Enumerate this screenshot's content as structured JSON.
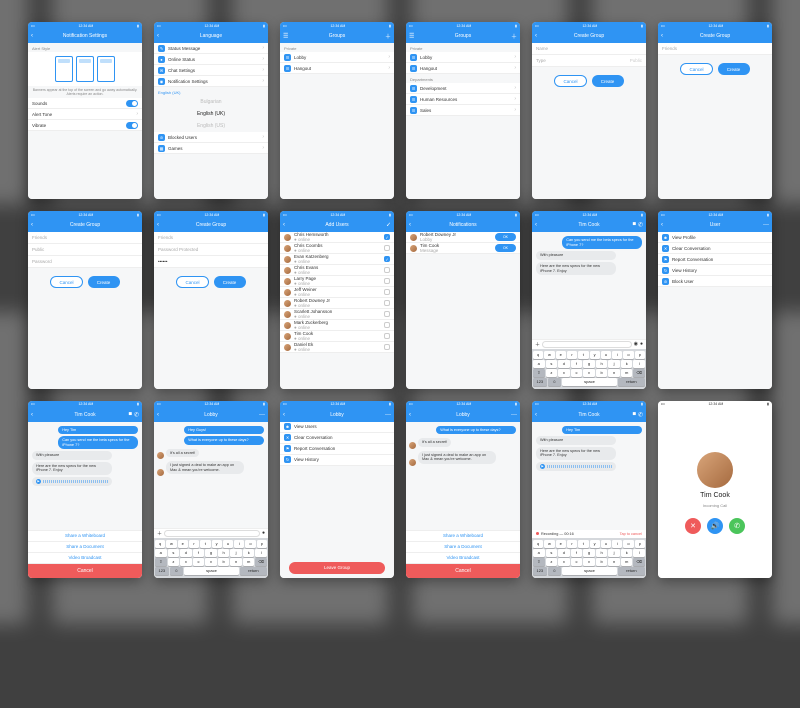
{
  "status": {
    "time": "12:34 AM"
  },
  "colors": {
    "primary": "#2f94f3",
    "danger": "#ef5b5b",
    "success": "#4bc55b"
  },
  "screens": {
    "notif_settings": {
      "title": "Notification Settings",
      "section": "Alert Style",
      "caption": "Banners appear at the top of the screen and go away automatically. Alerts require an action.",
      "rows": [
        {
          "label": "Sounds",
          "toggle": true
        },
        {
          "label": "Alert Tone",
          "chev": true
        },
        {
          "label": "Vibrate",
          "toggle": true
        }
      ]
    },
    "language": {
      "title": "Language",
      "settings": [
        {
          "label": "Status Message"
        },
        {
          "label": "Online Status"
        },
        {
          "label": "Chat Settings"
        },
        {
          "label": "Notification Settings"
        }
      ],
      "section_lang": "English (UK)",
      "langs": [
        {
          "label": "Bulgarian",
          "sel": false
        },
        {
          "label": "English (UK)",
          "sel": true
        },
        {
          "label": "English (US)",
          "sel": false
        }
      ],
      "more": [
        {
          "label": "Blocked Users"
        },
        {
          "label": "Games"
        }
      ]
    },
    "groups1": {
      "title": "Groups",
      "section": "Private",
      "items": [
        {
          "label": "Lobby"
        },
        {
          "label": "Hangout"
        }
      ]
    },
    "groups2": {
      "title": "Groups",
      "sec1": "Private",
      "items1": [
        {
          "label": "Lobby"
        },
        {
          "label": "Hangout"
        }
      ],
      "sec2": "Departments",
      "items2": [
        {
          "label": "Development"
        },
        {
          "label": "Human Resources"
        },
        {
          "label": "Sales"
        }
      ]
    },
    "create_group_a": {
      "title": "Create Group",
      "fields": [
        {
          "label": "Name"
        },
        {
          "label": "Type",
          "hint": "Public"
        }
      ],
      "cancel": "Cancel",
      "create": "Create"
    },
    "create_group_b": {
      "title": "Create Group",
      "fields": [
        {
          "label": "Friends"
        }
      ],
      "cancel": "Cancel",
      "create": "Create"
    },
    "create_group_c": {
      "title": "Create Group",
      "fields": [
        {
          "label": "Friends"
        },
        {
          "label": "Public"
        },
        {
          "label": "Password"
        }
      ],
      "cancel": "Cancel",
      "create": "Create"
    },
    "create_group_d": {
      "title": "Create Group",
      "fields": [
        {
          "label": "Friends"
        },
        {
          "label": "Password Protected"
        },
        {
          "value": "••••••"
        }
      ],
      "cancel": "Cancel",
      "create": "Create"
    },
    "add_users": {
      "title": "Add Users",
      "users": [
        {
          "name": "Chris Hemsworth",
          "on": true
        },
        {
          "name": "Chris Coombs",
          "on": false
        },
        {
          "name": "Evan Katzenberg",
          "on": true
        },
        {
          "name": "Chris Evans",
          "on": false
        },
        {
          "name": "Larry Page",
          "on": false
        },
        {
          "name": "Jeff Weiner",
          "on": false
        },
        {
          "name": "Robert Downey Jr",
          "on": false
        },
        {
          "name": "Scarlett Johansson",
          "on": false
        },
        {
          "name": "Mark Zuckerberg",
          "on": false
        },
        {
          "name": "Tim Cook",
          "on": false
        },
        {
          "name": "Daniel Ek",
          "on": false
        }
      ]
    },
    "notifications": {
      "title": "Notifications",
      "items": [
        {
          "name": "Robert Downey Jr",
          "sub": "Lobby"
        },
        {
          "name": "Tim Cook",
          "sub": "Message"
        }
      ],
      "ok": "OK"
    },
    "chat_tim": {
      "title": "Tim Cook",
      "msgs": [
        {
          "t": "Hey Tim",
          "sent": true
        },
        {
          "t": "Can you send me the beta specs for the iPhone 7?",
          "sent": true
        },
        {
          "t": "With pleasure",
          "sent": false
        },
        {
          "t": "Here are the new specs for the new iPhone 7. Enjoy",
          "sent": false
        },
        {
          "audio": true,
          "sent": false
        }
      ]
    },
    "user_actions": {
      "title": "User",
      "items": [
        {
          "label": "View Profile"
        },
        {
          "label": "Clear Conversation"
        },
        {
          "label": "Report Conversation"
        },
        {
          "label": "View History"
        },
        {
          "label": "Block User"
        }
      ]
    },
    "chat_share": {
      "title": "Tim Cook",
      "share": [
        {
          "label": "Share a Whiteboard"
        },
        {
          "label": "Share a Document"
        },
        {
          "label": "Video Broadcast"
        }
      ],
      "cancel": "Cancel"
    },
    "lobby_chat": {
      "title": "Lobby",
      "msgs": [
        {
          "t": "Hey Guys!",
          "sent": true
        },
        {
          "t": "What is everyone up to these days?",
          "sent": true
        },
        {
          "t": "It's all a secret!",
          "sent": false
        },
        {
          "t": "I just signed a deal to make an app on Mac & mean you're welcome.",
          "sent": false
        }
      ]
    },
    "lobby_actions": {
      "title": "Lobby",
      "items": [
        {
          "label": "View Users"
        },
        {
          "label": "Clear Conversation"
        },
        {
          "label": "Report Conversation"
        },
        {
          "label": "View History"
        }
      ],
      "leave": "Leave Group"
    },
    "lobby_share": {
      "title": "Lobby",
      "share": [
        {
          "label": "Share a Whiteboard"
        },
        {
          "label": "Share a Document"
        },
        {
          "label": "Video Broadcast"
        }
      ],
      "cancel": "Cancel"
    },
    "chat_rec": {
      "title": "Tim Cook",
      "rec_label": "Recording — 00:16",
      "tap": "Tap to cancel"
    },
    "incoming": {
      "name": "Tim Cook",
      "sub": "Incoming Call"
    }
  },
  "keyboard": {
    "r1": [
      "q",
      "w",
      "e",
      "r",
      "t",
      "y",
      "u",
      "i",
      "o",
      "p"
    ],
    "r2": [
      "a",
      "s",
      "d",
      "f",
      "g",
      "h",
      "j",
      "k",
      "l"
    ],
    "r3": [
      "⇧",
      "z",
      "x",
      "c",
      "v",
      "b",
      "n",
      "m",
      "⌫"
    ],
    "r4_fn": "123",
    "r4_space": "space",
    "r4_ret": "return"
  }
}
